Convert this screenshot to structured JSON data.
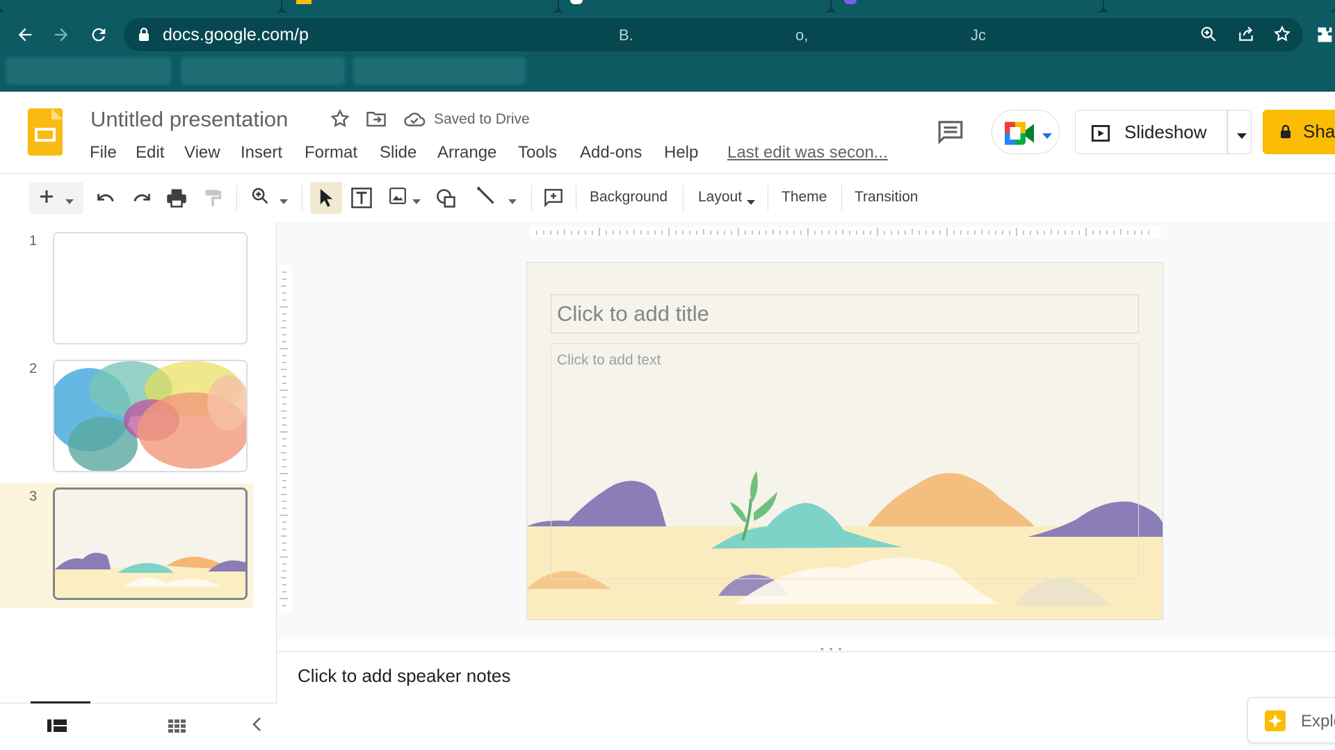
{
  "browser": {
    "url": "docs.google.com/p",
    "url_fragments": [
      "B.",
      "o,",
      "Jc"
    ]
  },
  "docs": {
    "title": "Untitled presentation",
    "saved_status": "Saved to Drive",
    "menu": [
      "File",
      "Edit",
      "View",
      "Insert",
      "Format",
      "Slide",
      "Arrange",
      "Tools",
      "Add-ons",
      "Help"
    ],
    "last_edit": "Last edit was secon...",
    "slideshow_label": "Slideshow",
    "share_label": "Sha"
  },
  "toolbar": {
    "background_label": "Background",
    "layout_label": "Layout",
    "theme_label": "Theme",
    "transition_label": "Transition"
  },
  "filmstrip": {
    "slides": [
      {
        "number": "1"
      },
      {
        "number": "2"
      },
      {
        "number": "3",
        "selected": true
      }
    ]
  },
  "slide": {
    "title_placeholder": "Click to add title",
    "body_placeholder": "Click to add text"
  },
  "notes": {
    "placeholder": "Click to add speaker notes"
  },
  "explore": {
    "label": "Explo"
  },
  "colors": {
    "chrome": "#0d5a63",
    "accent": "#fbbc04",
    "selection": "#fdf4dc"
  }
}
